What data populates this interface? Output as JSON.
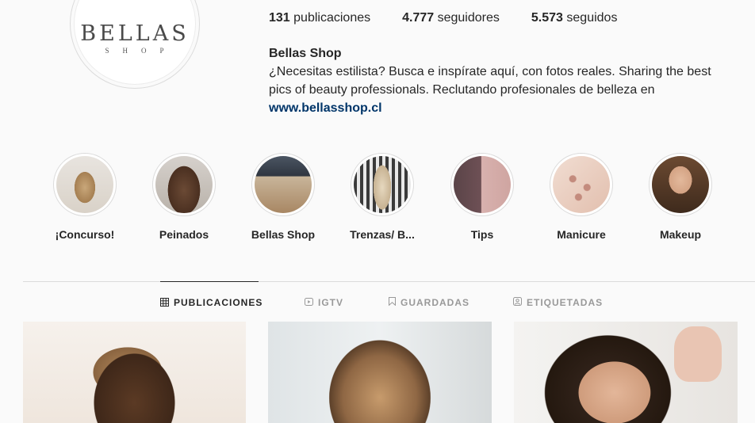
{
  "profile": {
    "logo_main": "BELLAS",
    "logo_sub": "SHOP",
    "stats": {
      "posts_count": "131",
      "posts_label": "publicaciones",
      "followers_count": "4.777",
      "followers_label": "seguidores",
      "following_count": "5.573",
      "following_label": "seguidos"
    },
    "name": "Bellas Shop",
    "bio": "¿Necesitas estilista? Busca e inspírate aquí, con fotos reales. Sharing the best pics of beauty professionals. Reclutando profesionales de belleza en",
    "link": "www.bellasshop.cl"
  },
  "highlights": [
    {
      "label": "¡Concurso!"
    },
    {
      "label": "Peinados"
    },
    {
      "label": "Bellas Shop"
    },
    {
      "label": "Trenzas/ B..."
    },
    {
      "label": "Tips"
    },
    {
      "label": "Manicure"
    },
    {
      "label": "Makeup"
    }
  ],
  "tabs": {
    "posts": {
      "label": "PUBLICACIONES",
      "icon": "grid-icon"
    },
    "igtv": {
      "label": "IGTV",
      "icon": "igtv-icon"
    },
    "saved": {
      "label": "GUARDADAS",
      "icon": "bookmark-icon"
    },
    "tagged": {
      "label": "ETIQUETADAS",
      "icon": "tag-icon"
    }
  },
  "colors": {
    "background": "#fafafa",
    "text": "#262626",
    "link": "#003569",
    "muted": "#999999",
    "border": "#dbdbdb"
  }
}
